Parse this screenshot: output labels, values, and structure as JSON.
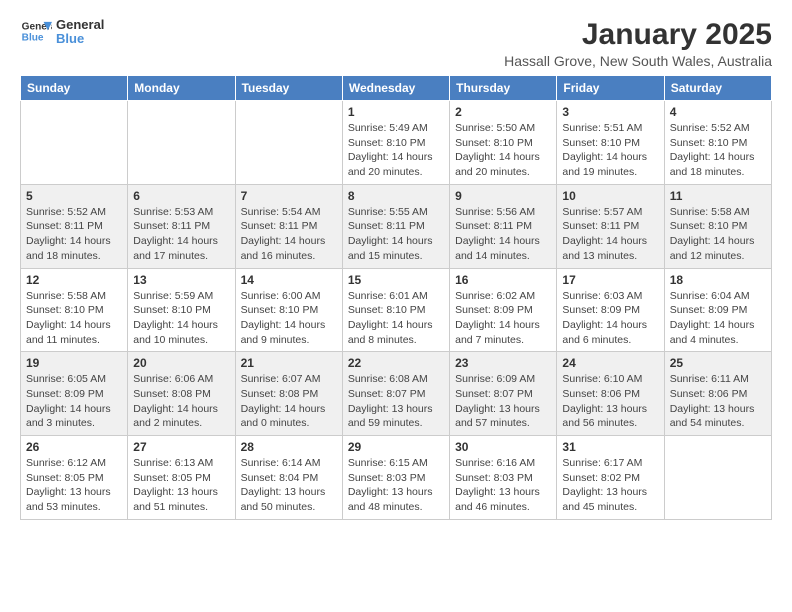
{
  "header": {
    "logo_line1": "General",
    "logo_line2": "Blue",
    "title": "January 2025",
    "subtitle": "Hassall Grove, New South Wales, Australia"
  },
  "weekdays": [
    "Sunday",
    "Monday",
    "Tuesday",
    "Wednesday",
    "Thursday",
    "Friday",
    "Saturday"
  ],
  "rows": [
    [
      {
        "day": "",
        "info": ""
      },
      {
        "day": "",
        "info": ""
      },
      {
        "day": "",
        "info": ""
      },
      {
        "day": "1",
        "info": "Sunrise: 5:49 AM\nSunset: 8:10 PM\nDaylight: 14 hours\nand 20 minutes."
      },
      {
        "day": "2",
        "info": "Sunrise: 5:50 AM\nSunset: 8:10 PM\nDaylight: 14 hours\nand 20 minutes."
      },
      {
        "day": "3",
        "info": "Sunrise: 5:51 AM\nSunset: 8:10 PM\nDaylight: 14 hours\nand 19 minutes."
      },
      {
        "day": "4",
        "info": "Sunrise: 5:52 AM\nSunset: 8:10 PM\nDaylight: 14 hours\nand 18 minutes."
      }
    ],
    [
      {
        "day": "5",
        "info": "Sunrise: 5:52 AM\nSunset: 8:11 PM\nDaylight: 14 hours\nand 18 minutes."
      },
      {
        "day": "6",
        "info": "Sunrise: 5:53 AM\nSunset: 8:11 PM\nDaylight: 14 hours\nand 17 minutes."
      },
      {
        "day": "7",
        "info": "Sunrise: 5:54 AM\nSunset: 8:11 PM\nDaylight: 14 hours\nand 16 minutes."
      },
      {
        "day": "8",
        "info": "Sunrise: 5:55 AM\nSunset: 8:11 PM\nDaylight: 14 hours\nand 15 minutes."
      },
      {
        "day": "9",
        "info": "Sunrise: 5:56 AM\nSunset: 8:11 PM\nDaylight: 14 hours\nand 14 minutes."
      },
      {
        "day": "10",
        "info": "Sunrise: 5:57 AM\nSunset: 8:11 PM\nDaylight: 14 hours\nand 13 minutes."
      },
      {
        "day": "11",
        "info": "Sunrise: 5:58 AM\nSunset: 8:10 PM\nDaylight: 14 hours\nand 12 minutes."
      }
    ],
    [
      {
        "day": "12",
        "info": "Sunrise: 5:58 AM\nSunset: 8:10 PM\nDaylight: 14 hours\nand 11 minutes."
      },
      {
        "day": "13",
        "info": "Sunrise: 5:59 AM\nSunset: 8:10 PM\nDaylight: 14 hours\nand 10 minutes."
      },
      {
        "day": "14",
        "info": "Sunrise: 6:00 AM\nSunset: 8:10 PM\nDaylight: 14 hours\nand 9 minutes."
      },
      {
        "day": "15",
        "info": "Sunrise: 6:01 AM\nSunset: 8:10 PM\nDaylight: 14 hours\nand 8 minutes."
      },
      {
        "day": "16",
        "info": "Sunrise: 6:02 AM\nSunset: 8:09 PM\nDaylight: 14 hours\nand 7 minutes."
      },
      {
        "day": "17",
        "info": "Sunrise: 6:03 AM\nSunset: 8:09 PM\nDaylight: 14 hours\nand 6 minutes."
      },
      {
        "day": "18",
        "info": "Sunrise: 6:04 AM\nSunset: 8:09 PM\nDaylight: 14 hours\nand 4 minutes."
      }
    ],
    [
      {
        "day": "19",
        "info": "Sunrise: 6:05 AM\nSunset: 8:09 PM\nDaylight: 14 hours\nand 3 minutes."
      },
      {
        "day": "20",
        "info": "Sunrise: 6:06 AM\nSunset: 8:08 PM\nDaylight: 14 hours\nand 2 minutes."
      },
      {
        "day": "21",
        "info": "Sunrise: 6:07 AM\nSunset: 8:08 PM\nDaylight: 14 hours\nand 0 minutes."
      },
      {
        "day": "22",
        "info": "Sunrise: 6:08 AM\nSunset: 8:07 PM\nDaylight: 13 hours\nand 59 minutes."
      },
      {
        "day": "23",
        "info": "Sunrise: 6:09 AM\nSunset: 8:07 PM\nDaylight: 13 hours\nand 57 minutes."
      },
      {
        "day": "24",
        "info": "Sunrise: 6:10 AM\nSunset: 8:06 PM\nDaylight: 13 hours\nand 56 minutes."
      },
      {
        "day": "25",
        "info": "Sunrise: 6:11 AM\nSunset: 8:06 PM\nDaylight: 13 hours\nand 54 minutes."
      }
    ],
    [
      {
        "day": "26",
        "info": "Sunrise: 6:12 AM\nSunset: 8:05 PM\nDaylight: 13 hours\nand 53 minutes."
      },
      {
        "day": "27",
        "info": "Sunrise: 6:13 AM\nSunset: 8:05 PM\nDaylight: 13 hours\nand 51 minutes."
      },
      {
        "day": "28",
        "info": "Sunrise: 6:14 AM\nSunset: 8:04 PM\nDaylight: 13 hours\nand 50 minutes."
      },
      {
        "day": "29",
        "info": "Sunrise: 6:15 AM\nSunset: 8:03 PM\nDaylight: 13 hours\nand 48 minutes."
      },
      {
        "day": "30",
        "info": "Sunrise: 6:16 AM\nSunset: 8:03 PM\nDaylight: 13 hours\nand 46 minutes."
      },
      {
        "day": "31",
        "info": "Sunrise: 6:17 AM\nSunset: 8:02 PM\nDaylight: 13 hours\nand 45 minutes."
      },
      {
        "day": "",
        "info": ""
      }
    ]
  ]
}
